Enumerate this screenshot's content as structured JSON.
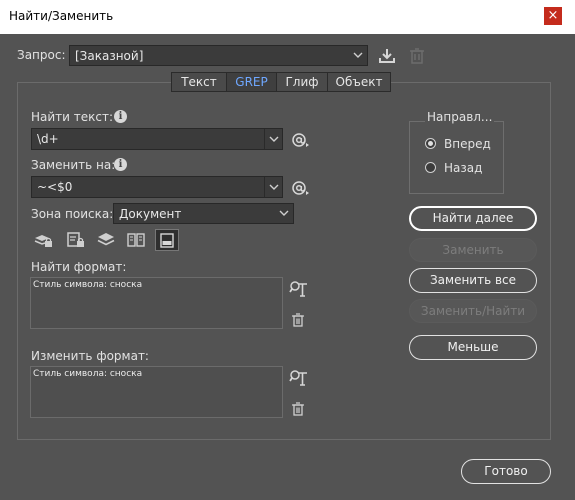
{
  "window": {
    "title": "Найти/Заменить",
    "close_glyph": "×"
  },
  "query": {
    "label": "Запрос:",
    "value": "[Заказной]",
    "save_icon": "save-query-icon",
    "delete_icon": "trash-icon"
  },
  "tabs": [
    {
      "label": "Текст",
      "active": false
    },
    {
      "label": "GREP",
      "active": true
    },
    {
      "label": "Глиф",
      "active": false
    },
    {
      "label": "Объект",
      "active": false
    }
  ],
  "find": {
    "label": "Найти текст:",
    "value": "\\d+",
    "special_icon": "at-special-chars-icon"
  },
  "replace": {
    "label": "Заменить на:",
    "value": "~<$0",
    "special_icon": "at-special-chars-icon"
  },
  "search_zone": {
    "label": "Зона поиска:",
    "value": "Документ"
  },
  "find_format": {
    "label": "Найти формат:",
    "text": "Стиль символа: сноска"
  },
  "change_format": {
    "label": "Изменить формат:",
    "text": "Стиль символа: сноска"
  },
  "direction": {
    "label": "Направл...",
    "options": [
      {
        "label": "Вперед",
        "selected": true
      },
      {
        "label": "Назад",
        "selected": false
      }
    ]
  },
  "buttons": {
    "find_next": "Найти далее",
    "replace": "Заменить",
    "replace_all": "Заменить все",
    "replace_find": "Заменить/Найти",
    "less": "Меньше",
    "done": "Готово"
  },
  "colors": {
    "background": "#535353",
    "active_tab_text": "#6fa7ff",
    "field": "#3b3b3b"
  }
}
